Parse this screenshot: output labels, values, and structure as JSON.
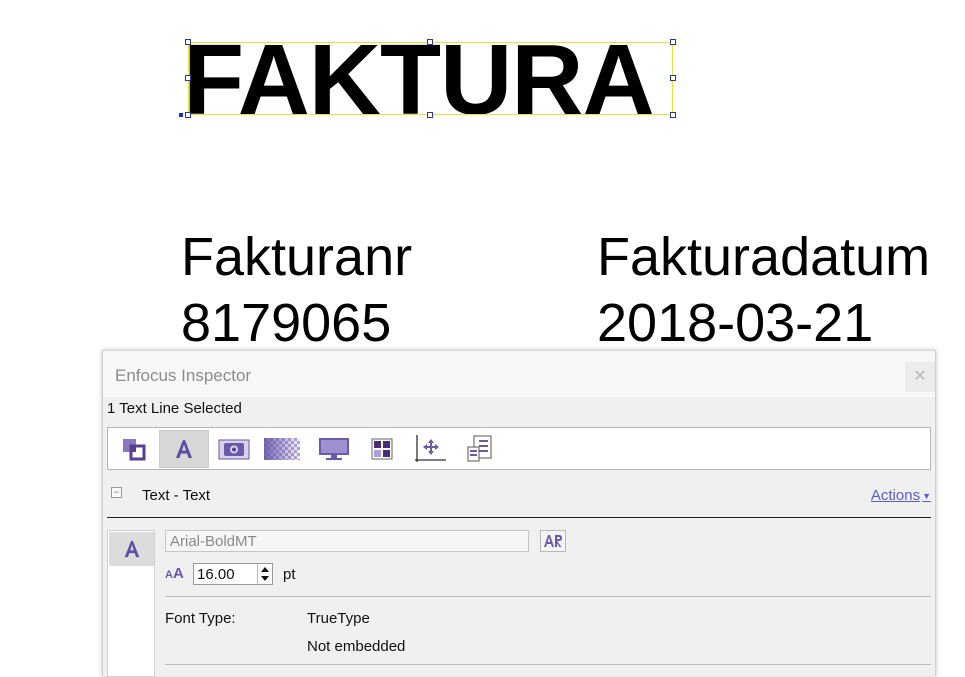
{
  "document": {
    "heading": "FAKTURA",
    "invoice_number_label": "Fakturanr",
    "invoice_number": "8179065",
    "invoice_date_label": "Fakturadatum",
    "invoice_date": "2018-03-21"
  },
  "inspector": {
    "title": "Enfocus Inspector",
    "close_glyph": "✕",
    "status": "1 Text Line Selected",
    "toolbar": [
      {
        "icon": "object-arrange-icon"
      },
      {
        "icon": "text-icon",
        "active": true
      },
      {
        "icon": "image-camera-icon"
      },
      {
        "icon": "transparency-icon"
      },
      {
        "icon": "display-monitor-icon"
      },
      {
        "icon": "layout-grid-icon"
      },
      {
        "icon": "position-move-icon"
      },
      {
        "icon": "document-info-icon"
      }
    ],
    "section": {
      "title": "Text - Text",
      "collapse_glyph": "−",
      "actions_label": "Actions"
    },
    "font": {
      "name": "Arial-BoldMT",
      "size_value": "16.00",
      "size_unit": "pt",
      "font_type_label": "Font Type:",
      "font_type_value": "TrueType",
      "embedding_status": "Not embedded"
    }
  },
  "colors": {
    "selection_box": "#e6e23c",
    "accent_purple": "#6b5aa8",
    "link": "#5a5ad6"
  }
}
